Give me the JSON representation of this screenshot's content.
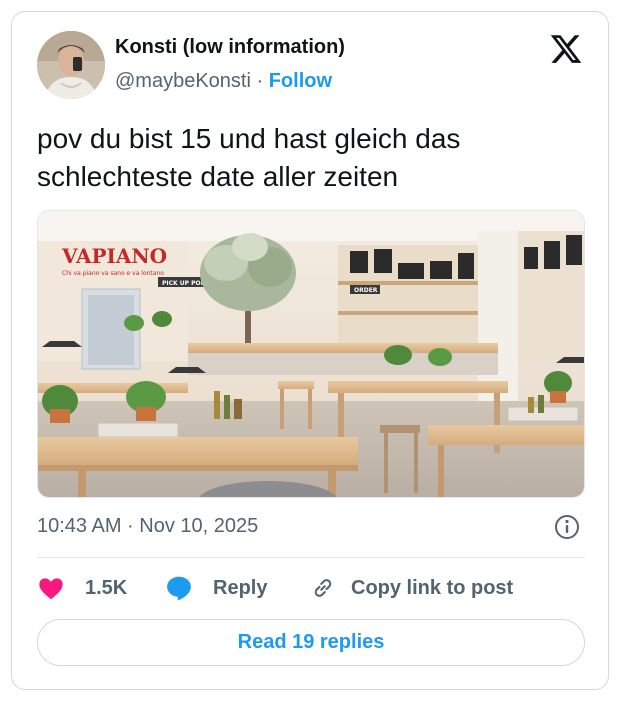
{
  "author": {
    "name": "Konsti (low information)",
    "handle": "@maybeKonsti",
    "separator": "·",
    "follow_label": "Follow"
  },
  "tweet": {
    "line1": "pov du bist 15 und hast gleich das",
    "line2": "schlechteste date aller zeiten"
  },
  "image": {
    "sign_brand": "VAPIANO",
    "sign_tagline": "Chi va piano va sano e va lontano",
    "sign_pickup": "PICK UP POINT",
    "sign_order": "ORDER"
  },
  "meta": {
    "timestamp": "10:43 AM · Nov 10, 2025"
  },
  "actions": {
    "likes": "1.5K",
    "reply_label": "Reply",
    "copy_label": "Copy link to post"
  },
  "read_replies_label": "Read 19 replies",
  "colors": {
    "accent": "#1d9bf0",
    "heart": "#f91880",
    "text_primary": "#0f1419",
    "text_secondary": "#536471",
    "border": "#cfd9de"
  }
}
